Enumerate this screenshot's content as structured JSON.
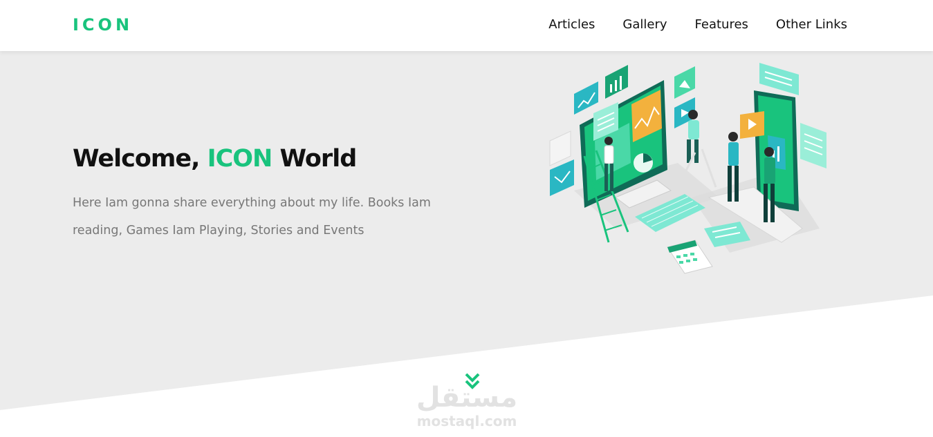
{
  "header": {
    "logo": "ICON",
    "nav": [
      {
        "label": "Articles"
      },
      {
        "label": "Gallery"
      },
      {
        "label": "Features"
      },
      {
        "label": "Other Links"
      }
    ]
  },
  "hero": {
    "title_prefix": "Welcome, ",
    "title_accent": "ICON",
    "title_suffix": " World",
    "description": "Here Iam gonna share everything about my life. Books Iam reading, Games Iam Playing, Stories and Events"
  },
  "watermark": {
    "arabic": "مستقل",
    "latin": "mostaql.com"
  },
  "colors": {
    "accent": "#19c37d",
    "hero_background": "#ececec",
    "text_dark": "#111111",
    "text_muted": "#777777"
  },
  "icons": [
    "team-dashboard-illustration",
    "double-chevron-down-icon"
  ]
}
